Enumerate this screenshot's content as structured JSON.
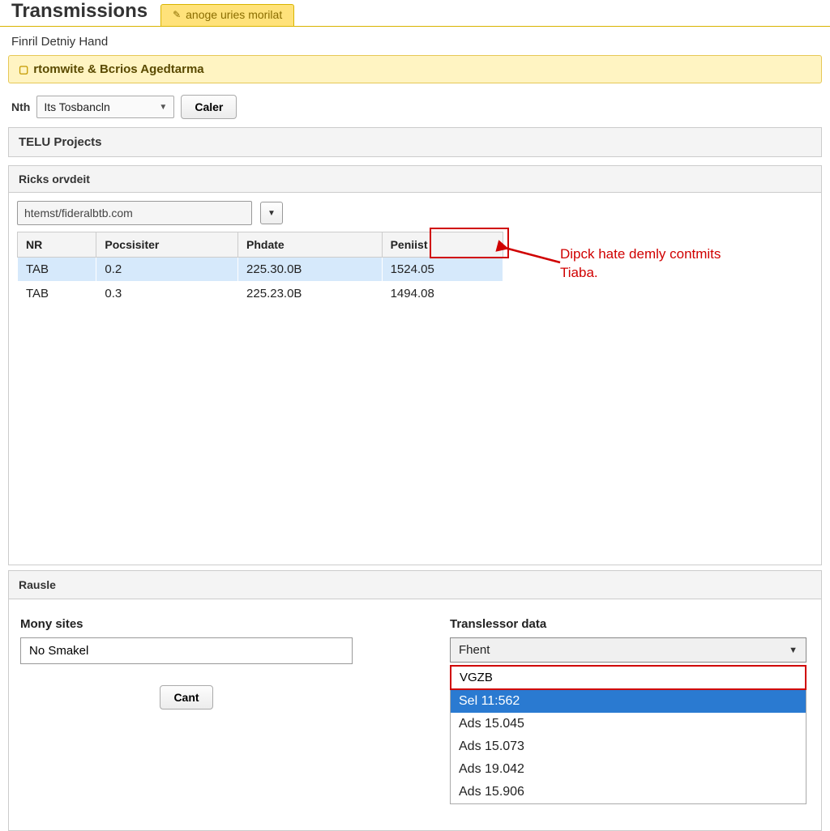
{
  "header": {
    "title": "Transmissions",
    "active_tab": "anoge uries morilat"
  },
  "subtitle": "Finril Detniy Hand",
  "yellow_bar": "rtomwite & Bcrios Agedtarma",
  "nth": {
    "label": "Nth",
    "value": "Its Tosbancln",
    "button": "Caler"
  },
  "panel1_title": "TELU Projects",
  "panel1_sub": "Ricks orvdeit",
  "filter_value": "htemst/fideralbtb.com",
  "table": {
    "cols": [
      "NR",
      "Pocsisiter",
      "Phdate",
      "Peniist"
    ],
    "rows": [
      {
        "nr": "TAB",
        "poc": "0.2",
        "ph": "225.30.0B",
        "pen": "1524.05"
      },
      {
        "nr": "TAB",
        "poc": "0.3",
        "ph": "225.23.0B",
        "pen": "1494.08"
      }
    ]
  },
  "callout": {
    "line1": "Dipck hate demly contmits",
    "line2": "Tiaba."
  },
  "panel2_title": "Rausle",
  "left": {
    "label": "Mony sites",
    "value": "No Smakel",
    "button": "Cant"
  },
  "right": {
    "label": "Translessor data",
    "selected": "Fhent",
    "search": "VGZB",
    "options": [
      "Sel 11:562",
      "Ads 15.045",
      "Ads 15.073",
      "Ads 19.042",
      "Ads 15.906"
    ],
    "highlighted_index": 0
  },
  "colors": {
    "callout_red": "#d00000",
    "yellow_bg": "#fff4c2",
    "yellow_border": "#e6c857",
    "select_blue": "#2a7ad1",
    "row_blue": "#d6e9fb"
  }
}
